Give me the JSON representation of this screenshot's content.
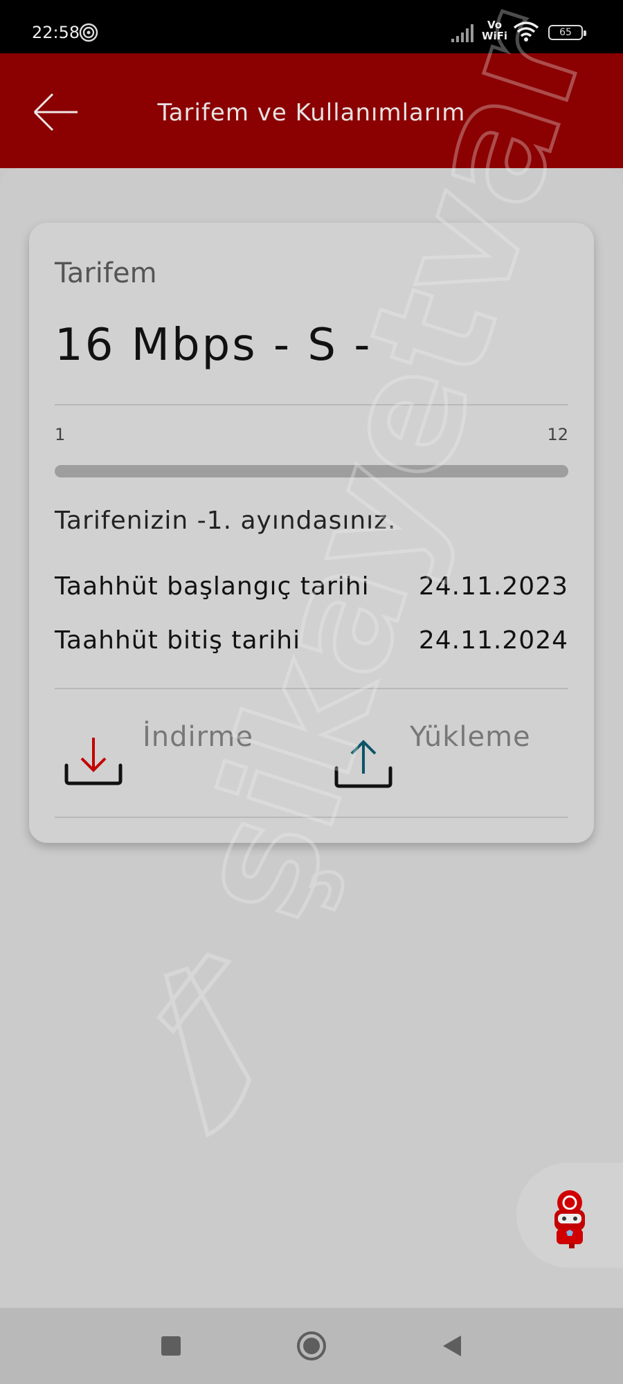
{
  "status_bar": {
    "time": "22:58",
    "vowifi_top": "Vo",
    "vowifi_bottom": "WiFi",
    "battery": "65",
    "icons": [
      "hotspot-icon",
      "signal-icon",
      "wifi-icon",
      "battery-icon"
    ]
  },
  "header": {
    "title": "Tarifem ve Kullanımlarım",
    "back_icon": "arrow-left-icon",
    "background": "#8b0000"
  },
  "tariff": {
    "label": "Tarifem",
    "name": "16 Mbps - S -",
    "months": {
      "start": "1",
      "end": "12",
      "current_fraction": 0
    },
    "month_info": "Tarifenizin -1. ayındasınız.",
    "commitment": [
      {
        "label": "Taahhüt başlangıç tarihi",
        "value": "24.11.2023"
      },
      {
        "label": "Taahhüt bitiş tarihi",
        "value": "24.11.2024"
      }
    ],
    "actions": [
      {
        "label": "İndirme",
        "icon": "download-icon",
        "color": "#c30000"
      },
      {
        "label": "Yükleme",
        "icon": "upload-icon",
        "color": "#0b5566"
      }
    ]
  },
  "watermark": "şikayetvar",
  "assistant": {
    "icon": "vodafone-assistant-icon"
  },
  "nav": {
    "buttons": [
      "recents-icon",
      "home-icon",
      "back-triangle-icon"
    ]
  }
}
